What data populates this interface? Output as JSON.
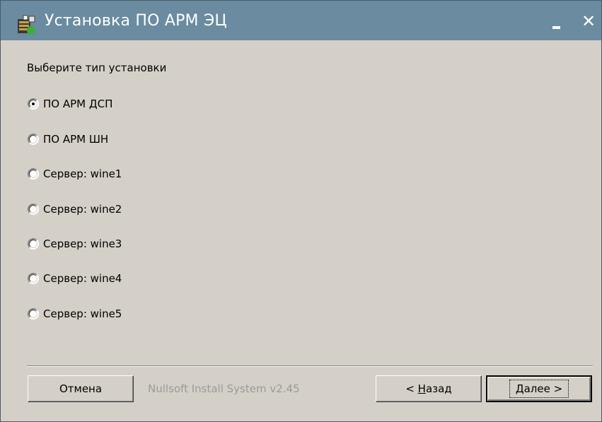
{
  "window": {
    "title": "Установка ПО АРМ ЭЦ",
    "minimize_label": "_",
    "close_label": "✕"
  },
  "prompt": "Выберите тип установки",
  "options": [
    {
      "label": "ПО АРМ ДСП",
      "checked": true
    },
    {
      "label": "ПО АРМ ШН",
      "checked": false
    },
    {
      "label": "Сервер: wine1",
      "checked": false
    },
    {
      "label": "Сервер: wine2",
      "checked": false
    },
    {
      "label": "Сервер: wine3",
      "checked": false
    },
    {
      "label": "Сервер: wine4",
      "checked": false
    },
    {
      "label": "Сервер: wine5",
      "checked": false
    }
  ],
  "footer": {
    "cancel_label": "Отмена",
    "branding": "Nullsoft Install System v2.45",
    "back_prefix": "< ",
    "back_accel": "Н",
    "back_rest": "азад",
    "next_accel": "Д",
    "next_rest": "алее >"
  },
  "colors": {
    "titlebar": "#6a8ba0",
    "face": "#d4d0c8",
    "disabled_text": "#9a9a9a"
  },
  "icons": {
    "app": "installer-icon",
    "minimize": "minimize-icon",
    "close": "close-icon"
  }
}
